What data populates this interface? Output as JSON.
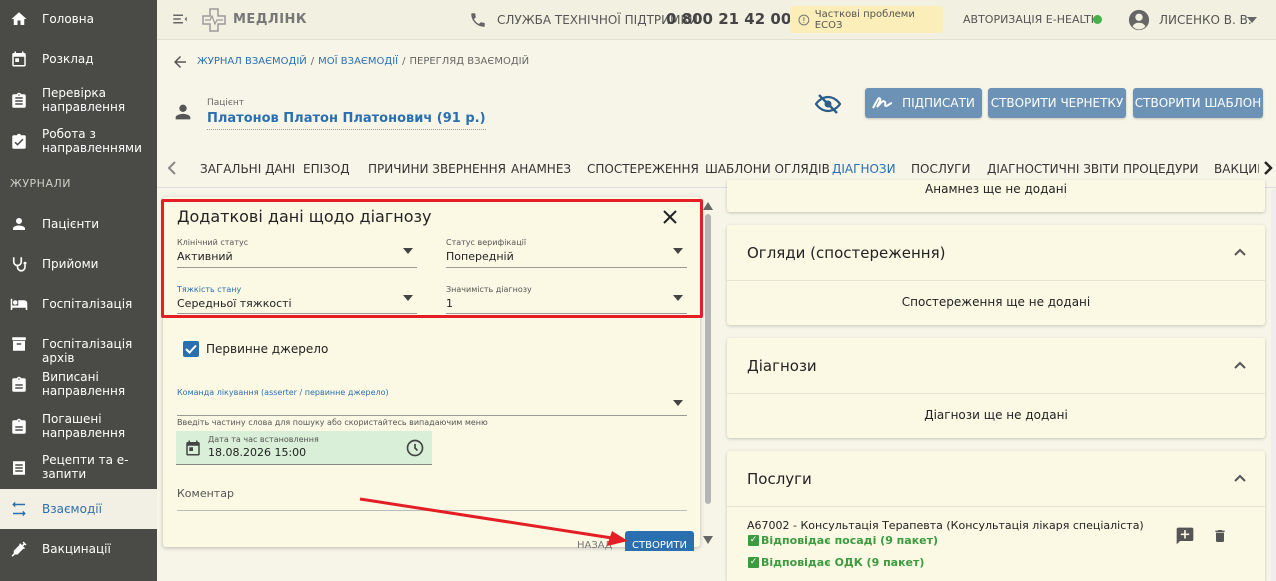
{
  "sidebar": {
    "items_top": [
      {
        "label": "Головна",
        "icon": "home-icon"
      },
      {
        "label": "Розклад",
        "icon": "calendar-icon"
      },
      {
        "label": "Перевірка направлення",
        "icon": "clipboard-icon"
      },
      {
        "label": "Робота з направленнями",
        "icon": "clipboard-check-icon"
      }
    ],
    "section_label": "ЖУРНАЛИ",
    "items_journals": [
      {
        "label": "Пацієнти",
        "icon": "person-icon"
      },
      {
        "label": "Прийоми",
        "icon": "stethoscope-icon"
      },
      {
        "label": "Госпіталізація",
        "icon": "bed-icon"
      },
      {
        "label": "Госпіталізація архів",
        "icon": "archive-icon"
      },
      {
        "label": "Виписані направлення",
        "icon": "clipboard-icon"
      },
      {
        "label": "Погашені направлення",
        "icon": "clipboard-icon"
      },
      {
        "label": "Рецепти та е-запити",
        "icon": "list-icon"
      },
      {
        "label": "Взаємодії",
        "icon": "swap-icon"
      },
      {
        "label": "Вакцинації",
        "icon": "syringe-icon"
      }
    ],
    "active": "Взаємодії"
  },
  "topbar": {
    "brand": "МЕДЛІНК",
    "support_label": "СЛУЖБА ТЕХНІЧНОЇ ПІДТРИМКИ",
    "support_phone": "0 800 21 42 00",
    "warning": "Часткові проблеми ЕСОЗ",
    "auth_label": "АВТОРИЗАЦІЯ E-HEALTH",
    "auth_status_color": "#47b04b",
    "user_name": "ЛИСЕНКО В. В."
  },
  "breadcrumb": {
    "items": [
      "ЖУРНАЛ ВЗАЄМОДІЙ",
      "МОЇ ВЗАЄМОДІЇ"
    ],
    "current": "ПЕРЕГЛЯД ВЗАЄМОДІЙ"
  },
  "patient": {
    "label": "Пацієнт",
    "name": "Платонов Платон Платонович (91 р.)"
  },
  "actions": {
    "sign": "ПІДПИСАТИ",
    "draft": "СТВОРИТИ ЧЕРНЕТКУ",
    "template": "СТВОРИТИ ШАБЛОН"
  },
  "tabs": {
    "items": [
      "ЗАГАЛЬНІ ДАНІ",
      "ЕПІЗОД",
      "ПРИЧИНИ ЗВЕРНЕННЯ",
      "АНАМНЕЗ",
      "СПОСТЕРЕЖЕННЯ",
      "ШАБЛОНИ ОГЛЯДІВ",
      "ДІАГНОЗИ",
      "ПОСЛУГИ",
      "ДІАГНОСТИЧНІ ЗВІТИ",
      "ПРОЦЕДУРИ",
      "ВАКЦИН"
    ],
    "active": "ДІАГНОЗИ"
  },
  "dialog": {
    "title": "Додаткові дані щодо діагнозу",
    "clinical_status": {
      "label": "Клінічний статус",
      "value": "Активний"
    },
    "verification_status": {
      "label": "Статус верифікації",
      "value": "Попередній"
    },
    "severity": {
      "label": "Тяжкість стану",
      "value": "Середньої тяжкості"
    },
    "rank": {
      "label": "Значимість діагнозу",
      "value": "1"
    },
    "primary_source": {
      "label": "Первинне джерело",
      "checked": true
    },
    "care_team": {
      "label": "Команда лікування (asserter / первинне джерело)",
      "value": ""
    },
    "hint": "Введіть частину слова для пошуку або скористайтесь випадаючим меню",
    "datetime": {
      "label": "Дата та час встановлення",
      "value": "18.08.2026 15:00"
    },
    "comment": {
      "placeholder": "Коментар"
    },
    "back_label": "НАЗАД",
    "create_label": "СТВОРИТИ"
  },
  "right_panels": {
    "anamnesis_empty": "Анамнез ще не додані",
    "observations": {
      "title": "Огляди (спостереження)",
      "empty": "Спостереження ще не додані"
    },
    "diagnoses": {
      "title": "Діагнози",
      "empty": "Діагнози ще не додані"
    },
    "services": {
      "title": "Послуги",
      "items": [
        {
          "text": "A67002 - Консультація Терапевта (Консультація лікаря спеціаліста)",
          "checks": [
            "Відповідає посаді (9 пакет)",
            "Відповідає ОДК (9 пакет)"
          ]
        }
      ]
    }
  }
}
